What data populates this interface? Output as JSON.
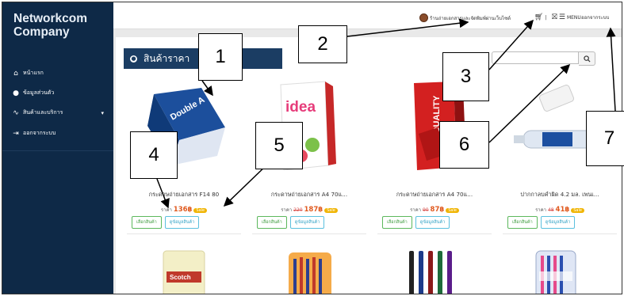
{
  "sidebar": {
    "brand_line1": "Networkcom",
    "brand_line2": "Company",
    "items": [
      {
        "label": "หน้าแรก",
        "icon": "home-icon",
        "glyph": "⌂"
      },
      {
        "label": "ข้อมูลส่วนตัว",
        "icon": "user-icon",
        "glyph": "●"
      },
      {
        "label": "สินค้าและบริการ",
        "icon": "chart-line-icon",
        "glyph": "∿"
      },
      {
        "label": "ออกจากระบบ",
        "icon": "logout-icon",
        "glyph": "⇥"
      }
    ]
  },
  "topbar": {
    "shop_name": "ร้านถ่ายเอกสารและจัดพิมพ์ผ่านเว็บไซต์",
    "cart_count": "|",
    "menu_label": "MENU",
    "logout_label": "ออกจากระบบ"
  },
  "content": {
    "section_title": "สินค้าราคา",
    "search_placeholder": "",
    "search_glyph": "🔍"
  },
  "products": [
    {
      "name": "กระดาษถ่ายเอกสาร F14 80",
      "price_label": "ราคา",
      "old_price": "",
      "new_price": "136฿",
      "sale_label": "Sale",
      "select_label": "เลือกสินค้า",
      "view_label": "ดูข้อมูลสินค้า"
    },
    {
      "name": "กระดาษถ่ายเอกสาร A4 70แ...",
      "price_label": "ราคา",
      "old_price": "220",
      "new_price": "187฿",
      "sale_label": "Sale",
      "select_label": "เลือกสินค้า",
      "view_label": "ดูข้อมูลสินค้า"
    },
    {
      "name": "กระดาษถ่ายเอกสาร A4 70แ...",
      "price_label": "ราคา",
      "old_price": "90",
      "new_price": "87฿",
      "sale_label": "Sale",
      "select_label": "เลือกสินค้า",
      "view_label": "ดูข้อมูลสินค้า"
    },
    {
      "name": "ปากกาลบคำผิด 4.2 มล. เพนเ...",
      "price_label": "ราคา",
      "old_price": "48",
      "new_price": "41฿",
      "sale_label": "Sale",
      "select_label": "เลือกสินค้า",
      "view_label": "ดูข้อมูลสินค้า"
    }
  ],
  "product_images": {
    "p1_label": "Double A",
    "p2_label": "idea",
    "p3_label": "QUALITY",
    "r2a_label": "Scotch"
  },
  "callouts": [
    "1",
    "2",
    "3",
    "4",
    "5",
    "6",
    "7"
  ],
  "colors": {
    "sidebar": "#0e2947",
    "header": "#1b3d63",
    "select_button": "#5cb85c",
    "view_button": "#5bc0de",
    "sale_badge": "#f0b400"
  }
}
